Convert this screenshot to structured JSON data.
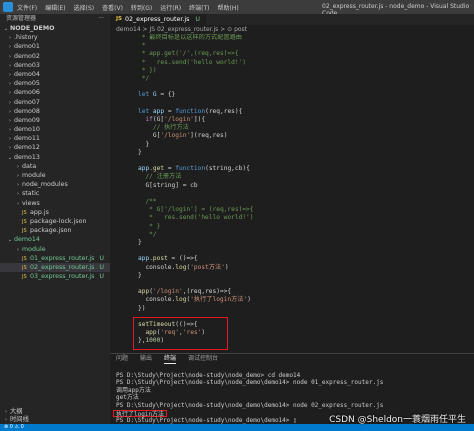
{
  "titlebar": {
    "menu": [
      "文件(F)",
      "编辑(E)",
      "选择(S)",
      "查看(V)",
      "转到(G)",
      "运行(R)",
      "终端(T)",
      "帮助(H)"
    ],
    "window_title": "02_express_router.js - node_demo - Visual Studio Code"
  },
  "sidebar": {
    "header": "资源管理器",
    "dots": "···",
    "items": [
      {
        "label": "NODE_DEMO",
        "type": "root",
        "arrow": "v",
        "badge": ""
      },
      {
        "label": ".history",
        "type": "folder",
        "arrow": ">",
        "badge": ""
      },
      {
        "label": "demo01",
        "type": "folder",
        "arrow": ">",
        "badge": ""
      },
      {
        "label": "demo02",
        "type": "folder",
        "arrow": ">",
        "badge": ""
      },
      {
        "label": "demo03",
        "type": "folder",
        "arrow": ">",
        "badge": ""
      },
      {
        "label": "demo04",
        "type": "folder",
        "arrow": ">",
        "badge": ""
      },
      {
        "label": "demo05",
        "type": "folder",
        "arrow": ">",
        "badge": ""
      },
      {
        "label": "demo06",
        "type": "folder",
        "arrow": ">",
        "badge": ""
      },
      {
        "label": "demo07",
        "type": "folder",
        "arrow": ">",
        "badge": ""
      },
      {
        "label": "demo08",
        "type": "folder",
        "arrow": ">",
        "badge": ""
      },
      {
        "label": "demo09",
        "type": "folder",
        "arrow": ">",
        "badge": ""
      },
      {
        "label": "demo10",
        "type": "folder",
        "arrow": ">",
        "badge": ""
      },
      {
        "label": "demo11",
        "type": "folder",
        "arrow": ">",
        "badge": ""
      },
      {
        "label": "demo12",
        "type": "folder",
        "arrow": ">",
        "badge": ""
      },
      {
        "label": "demo13",
        "type": "folder",
        "arrow": "v",
        "badge": ""
      },
      {
        "label": "data",
        "type": "folder-l2",
        "arrow": ">",
        "badge": ""
      },
      {
        "label": "module",
        "type": "folder-l2",
        "arrow": ">",
        "badge": ""
      },
      {
        "label": "node_modules",
        "type": "folder-l2",
        "arrow": ">",
        "badge": ""
      },
      {
        "label": "static",
        "type": "folder-l2",
        "arrow": ">",
        "badge": ""
      },
      {
        "label": "views",
        "type": "folder-l2",
        "arrow": ">",
        "badge": ""
      },
      {
        "label": "app.js",
        "type": "js-l2",
        "arrow": "",
        "badge": ""
      },
      {
        "label": "package-lock.json",
        "type": "json-l2",
        "arrow": "",
        "badge": ""
      },
      {
        "label": "package.json",
        "type": "json-l2",
        "arrow": "",
        "badge": ""
      },
      {
        "label": "demo14",
        "type": "folder",
        "arrow": "v",
        "badge": "",
        "green": true
      },
      {
        "label": "module",
        "type": "folder-l2",
        "arrow": ">",
        "badge": "",
        "green": true
      },
      {
        "label": "01_express_router.js",
        "type": "js-l2",
        "arrow": "",
        "badge": "U",
        "green": true
      },
      {
        "label": "02_express_router.js",
        "type": "js-l2",
        "arrow": "",
        "badge": "U",
        "green": true,
        "selected": true
      },
      {
        "label": "03_express_router.js",
        "type": "js-l2",
        "arrow": "",
        "badge": "U",
        "green": true
      }
    ],
    "bottom": [
      {
        "label": "大纲",
        "arrow": ">"
      },
      {
        "label": "时间线",
        "arrow": ">"
      }
    ]
  },
  "editor": {
    "tab_label": "02_express_router.js",
    "tab_badge": "JS",
    "tab_status": "U",
    "breadcrumb": "demo14 > JS 02_express_router.js > ⊙ post",
    "lines": [
      {
        "ln": "",
        "html": [
          [
            "c-comment",
            " * 最终目标是以这样的方式配置路由"
          ]
        ]
      },
      {
        "ln": "",
        "html": [
          [
            "c-comment",
            " *"
          ]
        ]
      },
      {
        "ln": "",
        "html": [
          [
            "c-comment",
            " * app.get('/',(req,res)=>{"
          ]
        ]
      },
      {
        "ln": "",
        "html": [
          [
            "c-comment",
            " *   res.send('hello world!')"
          ]
        ]
      },
      {
        "ln": "",
        "html": [
          [
            "c-comment",
            " * })"
          ]
        ]
      },
      {
        "ln": "",
        "html": [
          [
            "c-comment",
            " */"
          ]
        ]
      },
      {
        "ln": "",
        "html": []
      },
      {
        "ln": "",
        "html": [
          [
            "c-kw",
            "let "
          ],
          [
            "c-var",
            "G"
          ],
          [
            "c-plain",
            " = {}"
          ]
        ]
      },
      {
        "ln": "",
        "html": []
      },
      {
        "ln": "",
        "html": [
          [
            "c-kw",
            "let "
          ],
          [
            "c-var",
            "app"
          ],
          [
            "c-plain",
            " = "
          ],
          [
            "c-kw",
            "function"
          ],
          [
            "c-plain",
            "(req,res){"
          ]
        ]
      },
      {
        "ln": "",
        "html": [
          [
            "c-plain",
            "  "
          ],
          [
            "c-ctrl",
            "if"
          ],
          [
            "c-plain",
            "(G["
          ],
          [
            "c-str",
            "'/login'"
          ],
          [
            "c-plain",
            "]){"
          ]
        ]
      },
      {
        "ln": "",
        "html": [
          [
            "c-comment",
            "    // 执行方法"
          ]
        ]
      },
      {
        "ln": "",
        "html": [
          [
            "c-plain",
            "    G["
          ],
          [
            "c-str",
            "'/login'"
          ],
          [
            "c-plain",
            "](req,res)"
          ]
        ]
      },
      {
        "ln": "",
        "html": [
          [
            "c-plain",
            "  }"
          ]
        ]
      },
      {
        "ln": "",
        "html": [
          [
            "c-plain",
            "}"
          ]
        ]
      },
      {
        "ln": "",
        "html": []
      },
      {
        "ln": "",
        "html": [
          [
            "c-var",
            "app"
          ],
          [
            "c-plain",
            "."
          ],
          [
            "c-fn",
            "get"
          ],
          [
            "c-plain",
            " = "
          ],
          [
            "c-kw",
            "function"
          ],
          [
            "c-plain",
            "(string,cb){"
          ]
        ]
      },
      {
        "ln": "",
        "html": [
          [
            "c-comment",
            "  // 注册方法"
          ]
        ]
      },
      {
        "ln": "",
        "html": [
          [
            "c-plain",
            "  G[string] = cb"
          ]
        ]
      },
      {
        "ln": "",
        "html": []
      },
      {
        "ln": "",
        "html": [
          [
            "c-comment",
            "  /**"
          ]
        ]
      },
      {
        "ln": "",
        "html": [
          [
            "c-comment",
            "   * G['/login'] = (req,res)=>{"
          ]
        ]
      },
      {
        "ln": "",
        "html": [
          [
            "c-comment",
            "   *   res.send('hello world!')"
          ]
        ]
      },
      {
        "ln": "",
        "html": [
          [
            "c-comment",
            "   * }"
          ]
        ]
      },
      {
        "ln": "",
        "html": [
          [
            "c-comment",
            "   */"
          ]
        ]
      },
      {
        "ln": "",
        "html": [
          [
            "c-plain",
            "}"
          ]
        ]
      },
      {
        "ln": "",
        "html": []
      },
      {
        "ln": "",
        "html": [
          [
            "c-var",
            "app"
          ],
          [
            "c-plain",
            "."
          ],
          [
            "c-fn",
            "post"
          ],
          [
            "c-plain",
            " = ()=>{"
          ]
        ]
      },
      {
        "ln": "",
        "html": [
          [
            "c-plain",
            "  console."
          ],
          [
            "c-fn",
            "log"
          ],
          [
            "c-plain",
            "("
          ],
          [
            "c-str",
            "'post方法'"
          ],
          [
            "c-plain",
            ")"
          ]
        ]
      },
      {
        "ln": "",
        "html": [
          [
            "c-plain",
            "}"
          ]
        ]
      },
      {
        "ln": "",
        "html": []
      },
      {
        "ln": "",
        "html": [
          [
            "c-fn",
            "app"
          ],
          [
            "c-plain",
            "("
          ],
          [
            "c-str",
            "'/login'"
          ],
          [
            "c-plain",
            ",(req,res)=>{"
          ]
        ]
      },
      {
        "ln": "",
        "html": [
          [
            "c-plain",
            "  console."
          ],
          [
            "c-fn",
            "log"
          ],
          [
            "c-plain",
            "("
          ],
          [
            "c-str",
            "'执行了login方法'"
          ],
          [
            "c-plain",
            ")"
          ]
        ]
      },
      {
        "ln": "",
        "html": [
          [
            "c-plain",
            "})"
          ]
        ]
      },
      {
        "ln": "",
        "html": []
      },
      {
        "ln": "",
        "html": [
          [
            "c-fn",
            "setTimeout"
          ],
          [
            "c-plain",
            "(()=>{"
          ]
        ]
      },
      {
        "ln": "",
        "html": [
          [
            "c-plain",
            "  "
          ],
          [
            "c-fn",
            "app"
          ],
          [
            "c-plain",
            "("
          ],
          [
            "c-str",
            "'req'"
          ],
          [
            "c-plain",
            ","
          ],
          [
            "c-str",
            "'res'"
          ],
          [
            "c-plain",
            ")"
          ]
        ]
      },
      {
        "ln": "",
        "html": [
          [
            "c-plain",
            "},"
          ],
          [
            "c-num",
            "1000"
          ],
          [
            "c-plain",
            ")"
          ]
        ]
      },
      {
        "ln": "",
        "html": []
      }
    ]
  },
  "panel": {
    "tabs": [
      "问题",
      "输出",
      "终端",
      "调试控制台"
    ],
    "active_tab": 2,
    "terminal_lines": [
      "",
      "PS D:\\Study\\Project\\node-study\\node_demo> cd demo14",
      "PS D:\\Study\\Project\\node-study\\node_demo\\demo14> node 01_express_router.js",
      "调用app方法",
      "get方法",
      "PS D:\\Study\\Project\\node-study\\node_demo\\demo14> node 02_express_router.js",
      "执行了login方法",
      "PS D:\\Study\\Project\\node-study\\node_demo\\demo14> ▯"
    ],
    "boxed_line_index": 6
  },
  "statusbar": {
    "left": "⊗ 0 ⚠ 0"
  },
  "watermark": "CSDN @Sheldon一蓑烟雨任平生"
}
